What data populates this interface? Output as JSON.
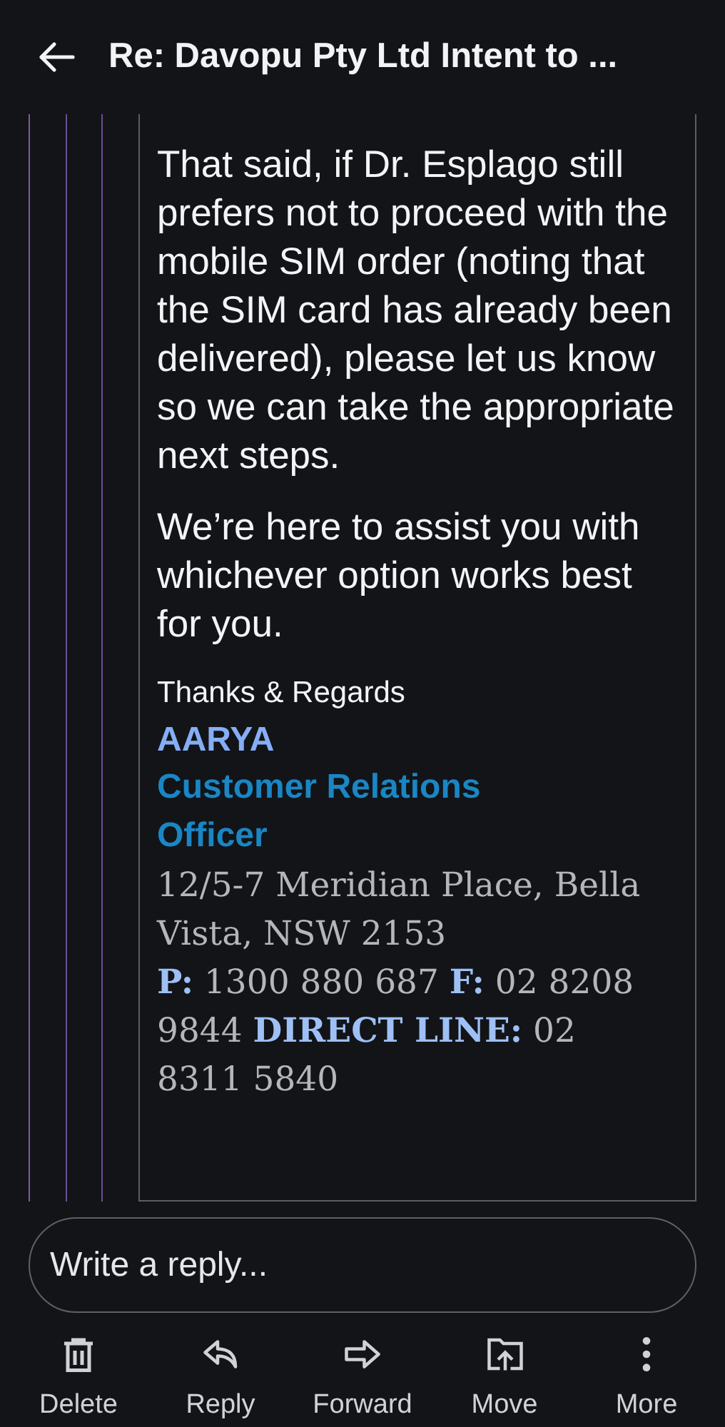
{
  "header": {
    "title": "Re: Davopu Pty Ltd Intent to ..."
  },
  "message": {
    "paragraphs": [
      "That said, if Dr. Esplago still prefers not to proceed with the mobile SIM order (noting that the SIM card has already been delivered), please let us know so we can take the appropriate next steps.",
      "We’re here to assist you with whichever option works best for you."
    ],
    "signature": {
      "closing": "Thanks & Regards",
      "name": "AARYA",
      "role": "Customer Relations Officer",
      "address": "12/5-7 Meridian Place, Bella Vista, NSW 2153",
      "contact": "**P:** 1300 880 687 **F:** 02 8208 9844 **DIRECT LINE:** 02 8311 5840"
    }
  },
  "reply": {
    "placeholder": "Write a reply..."
  },
  "actions": [
    {
      "kind": "delete",
      "label": "Delete"
    },
    {
      "kind": "reply",
      "label": "Reply"
    },
    {
      "kind": "forward",
      "label": "Forward"
    },
    {
      "kind": "move",
      "label": "Move"
    },
    {
      "kind": "more",
      "label": "More"
    }
  ]
}
